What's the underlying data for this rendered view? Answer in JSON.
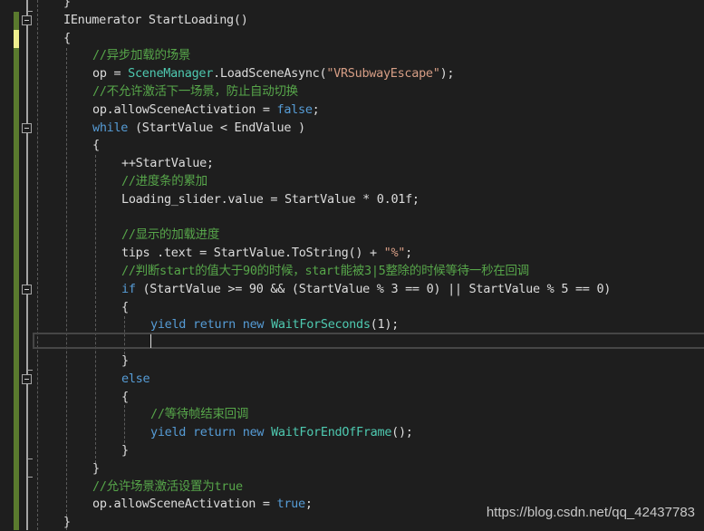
{
  "editor": {
    "lines": [
      {
        "indent": 0,
        "tokens": [
          {
            "t": "}",
            "c": ""
          }
        ]
      },
      {
        "indent": 0,
        "tokens": [
          {
            "t": "IEnumerator StartLoading()",
            "c": ""
          }
        ]
      },
      {
        "indent": 0,
        "tokens": [
          {
            "t": "{",
            "c": ""
          }
        ]
      },
      {
        "indent": 1,
        "tokens": [
          {
            "t": "//异步加载的场景",
            "c": "cm"
          }
        ]
      },
      {
        "indent": 1,
        "tokens": [
          {
            "t": "op = ",
            "c": ""
          },
          {
            "t": "SceneManager",
            "c": "ty"
          },
          {
            "t": ".LoadSceneAsync(",
            "c": ""
          },
          {
            "t": "\"VRSubwayEscape\"",
            "c": "str"
          },
          {
            "t": ");",
            "c": ""
          }
        ]
      },
      {
        "indent": 1,
        "tokens": [
          {
            "t": "//不允许激活下一场景，防止自动切换",
            "c": "cm"
          }
        ]
      },
      {
        "indent": 1,
        "tokens": [
          {
            "t": "op.allowSceneActivation = ",
            "c": ""
          },
          {
            "t": "false",
            "c": "kw"
          },
          {
            "t": ";",
            "c": ""
          }
        ]
      },
      {
        "indent": 1,
        "tokens": [
          {
            "t": "while",
            "c": "kw"
          },
          {
            "t": " (StartValue < EndValue )",
            "c": ""
          }
        ]
      },
      {
        "indent": 1,
        "tokens": [
          {
            "t": "{",
            "c": ""
          }
        ]
      },
      {
        "indent": 2,
        "tokens": [
          {
            "t": "++StartValue;",
            "c": ""
          }
        ]
      },
      {
        "indent": 2,
        "tokens": [
          {
            "t": "//进度条的累加",
            "c": "cm"
          }
        ]
      },
      {
        "indent": 2,
        "tokens": [
          {
            "t": "Loading_slider.value = StartValue * 0.01f;",
            "c": ""
          }
        ]
      },
      {
        "indent": 2,
        "tokens": [
          {
            "t": "",
            "c": ""
          }
        ]
      },
      {
        "indent": 2,
        "tokens": [
          {
            "t": "//显示的加载进度",
            "c": "cm"
          }
        ]
      },
      {
        "indent": 2,
        "tokens": [
          {
            "t": "tips .text = StartValue.ToString() + ",
            "c": ""
          },
          {
            "t": "\"%\"",
            "c": "str"
          },
          {
            "t": ";",
            "c": ""
          }
        ]
      },
      {
        "indent": 2,
        "tokens": [
          {
            "t": "//判断start的值大于90的时候，start能被3|5整除的时候等待一秒在回调",
            "c": "cm"
          }
        ]
      },
      {
        "indent": 2,
        "tokens": [
          {
            "t": "if",
            "c": "kw"
          },
          {
            "t": " (StartValue >= 90 && (StartValue % 3 == 0) || StartValue % 5 == 0)",
            "c": ""
          }
        ]
      },
      {
        "indent": 2,
        "tokens": [
          {
            "t": "{",
            "c": ""
          }
        ]
      },
      {
        "indent": 3,
        "tokens": [
          {
            "t": "yield return new",
            "c": "kw"
          },
          {
            "t": " ",
            "c": ""
          },
          {
            "t": "WaitForSeconds",
            "c": "ty"
          },
          {
            "t": "(1);",
            "c": ""
          }
        ]
      },
      {
        "indent": 3,
        "tokens": [
          {
            "t": "",
            "c": ""
          }
        ]
      },
      {
        "indent": 2,
        "tokens": [
          {
            "t": "}",
            "c": ""
          }
        ]
      },
      {
        "indent": 2,
        "tokens": [
          {
            "t": "else",
            "c": "kw"
          }
        ]
      },
      {
        "indent": 2,
        "tokens": [
          {
            "t": "{",
            "c": ""
          }
        ]
      },
      {
        "indent": 3,
        "tokens": [
          {
            "t": "//等待帧结束回调",
            "c": "cm"
          }
        ]
      },
      {
        "indent": 3,
        "tokens": [
          {
            "t": "yield return new",
            "c": "kw"
          },
          {
            "t": " ",
            "c": ""
          },
          {
            "t": "WaitForEndOfFrame",
            "c": "ty"
          },
          {
            "t": "();",
            "c": ""
          }
        ]
      },
      {
        "indent": 2,
        "tokens": [
          {
            "t": "}",
            "c": ""
          }
        ]
      },
      {
        "indent": 1,
        "tokens": [
          {
            "t": "}",
            "c": ""
          }
        ]
      },
      {
        "indent": 1,
        "tokens": [
          {
            "t": "//允许场景激活设置为true",
            "c": "cm"
          }
        ]
      },
      {
        "indent": 1,
        "tokens": [
          {
            "t": "op.allowSceneActivation = ",
            "c": ""
          },
          {
            "t": "true",
            "c": "kw"
          },
          {
            "t": ";",
            "c": ""
          }
        ]
      },
      {
        "indent": 0,
        "tokens": [
          {
            "t": "}",
            "c": ""
          }
        ]
      }
    ],
    "fold_markers": [
      "IEnumerator StartLoading()",
      "while",
      "if",
      "else"
    ]
  },
  "watermark": "https://blog.csdn.net/qq_42437783"
}
